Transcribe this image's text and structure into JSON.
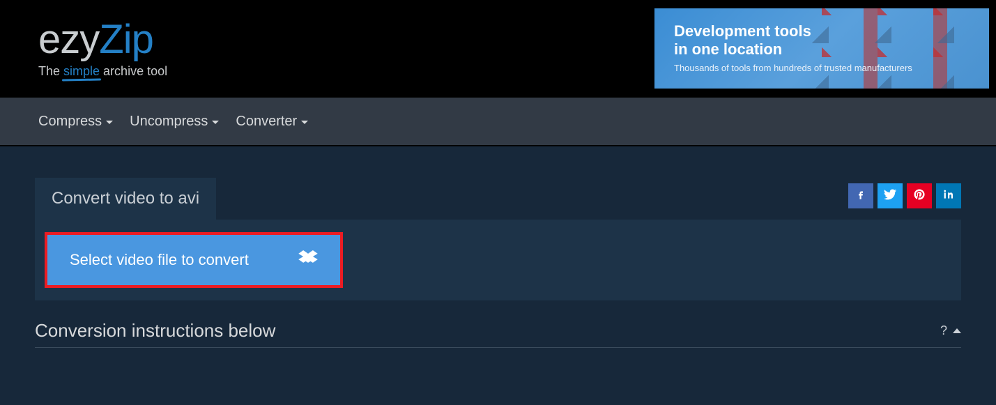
{
  "brand": {
    "logo_part1": "ezy",
    "logo_part2": "Zip",
    "tagline_pre": "The ",
    "tagline_highlight": "simple",
    "tagline_post": " archive tool"
  },
  "ad": {
    "title_line1": "Development tools",
    "title_line2": "in one location",
    "subtitle": "Thousands of tools from hundreds of trusted manufacturers"
  },
  "nav": {
    "compress": "Compress",
    "uncompress": "Uncompress",
    "converter": "Converter"
  },
  "page": {
    "tab_title": "Convert video to avi",
    "select_button": "Select video file to convert",
    "instructions_title": "Conversion instructions below",
    "help_symbol": "?"
  },
  "social": {
    "facebook": "facebook",
    "twitter": "twitter",
    "pinterest": "pinterest",
    "linkedin": "linkedin"
  }
}
